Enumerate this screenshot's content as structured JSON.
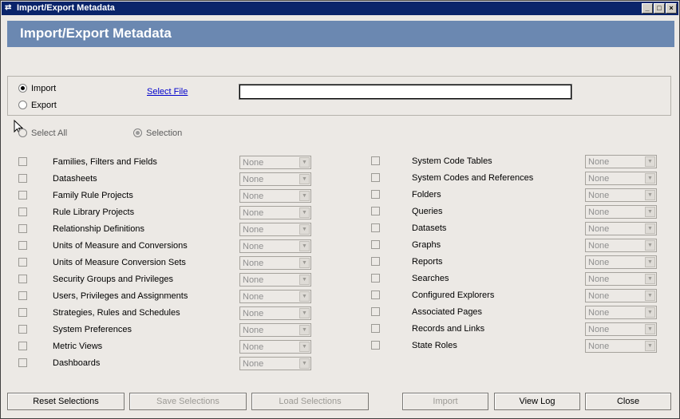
{
  "window": {
    "title": "Import/Export Metadata",
    "minimize_glyph": "_",
    "maximize_glyph": "□",
    "close_glyph": "×"
  },
  "banner": {
    "title": "Import/Export Metadata"
  },
  "mode": {
    "import_label": "Import",
    "export_label": "Export",
    "selected": "Import",
    "select_file_link": "Select File",
    "file_path": ""
  },
  "select_all_label": "Select All",
  "selection_label": "Selection",
  "dropdown_default": "None",
  "left_items": [
    "Families, Filters and Fields",
    "Datasheets",
    "Family Rule Projects",
    "Rule Library Projects",
    "Relationship Definitions",
    "Units of Measure and Conversions",
    "Units of Measure Conversion Sets",
    "Security Groups and Privileges",
    "Users, Privileges and Assignments",
    "Strategies, Rules and Schedules",
    "System Preferences",
    "Metric Views",
    "Dashboards"
  ],
  "right_items": [
    "System Code Tables",
    "System Codes and References",
    "Folders",
    "Queries",
    "Datasets",
    "Graphs",
    "Reports",
    "Searches",
    "Configured Explorers",
    "Associated Pages",
    "Records and Links",
    "State Roles"
  ],
  "buttons": {
    "reset": "Reset Selections",
    "save": "Save Selections",
    "load": "Load Selections",
    "import": "Import",
    "view_log": "View Log",
    "close": "Close"
  },
  "colors": {
    "title_bar": "#0a246a",
    "banner": "#6b88b1",
    "window_bg": "#ece9e5",
    "link": "#0000cc"
  }
}
